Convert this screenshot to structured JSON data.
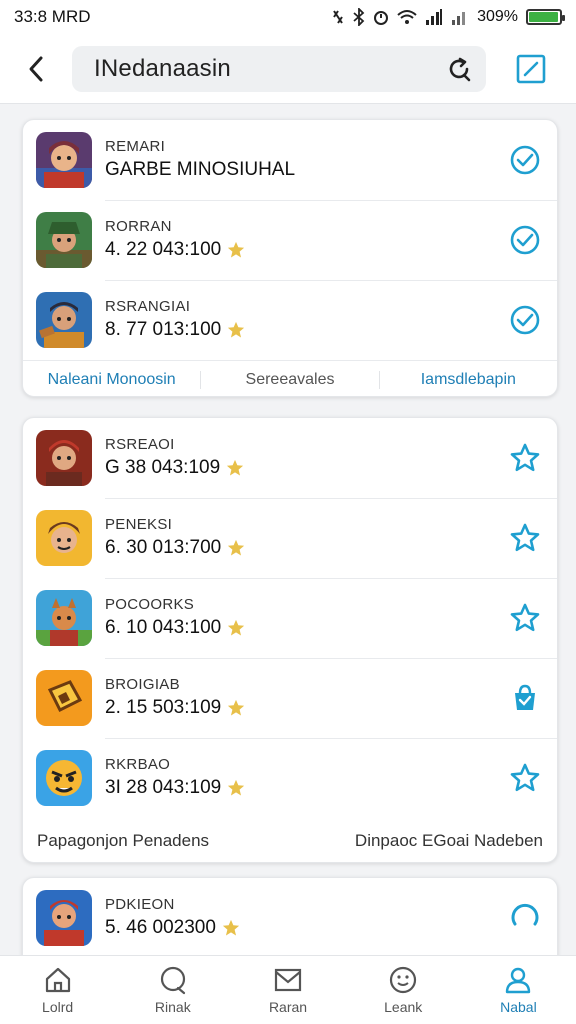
{
  "status_bar": {
    "time": "33:8 MRD",
    "battery_text": "309%",
    "battery_level": 0.95,
    "icons": [
      "nfc-icon",
      "bluetooth-icon",
      "alarm-icon",
      "wifi-icon",
      "signal-icon",
      "signal-icon-2",
      "battery-icon"
    ]
  },
  "header": {
    "search_value": "INedanaasin",
    "back_icon": "chevron-left-icon",
    "refresh_icon": "refresh-icon",
    "edit_icon": "edit-icon"
  },
  "colors": {
    "accent": "#1f9fd0",
    "star": "#e8c04a",
    "active_text": "#1f7fb5"
  },
  "card1": {
    "rows": [
      {
        "title": "REMARI",
        "sub": "GARBE MINOSIUHAL",
        "has_star": false,
        "action": "check-circle-icon"
      },
      {
        "title": "RORRAN",
        "sub": "4. 22 043:100",
        "has_star": true,
        "action": "check-circle-icon"
      },
      {
        "title": "RSRANGIAI",
        "sub": "8. 77 013:100",
        "has_star": true,
        "action": "check-circle-icon"
      }
    ],
    "footer_tabs": [
      "Naleani Monoosin",
      "Sereeavales",
      "Iamsdlebapin"
    ]
  },
  "card2": {
    "rows": [
      {
        "title": "RSREAOI",
        "sub": "G 38 043:109",
        "has_star": true,
        "action": "star-outline-icon"
      },
      {
        "title": "PENEKSI",
        "sub": "6. 30 013:700",
        "has_star": true,
        "action": "star-outline-icon"
      },
      {
        "title": "POCOORKS",
        "sub": "6. 10 043:100",
        "has_star": true,
        "action": "star-outline-icon"
      },
      {
        "title": "BROIGIAB",
        "sub": "2. 15 503:109",
        "has_star": true,
        "action": "shopping-bag-icon"
      },
      {
        "title": "RKRBAO",
        "sub": "3I 28 043:109",
        "has_star": true,
        "action": "star-outline-icon"
      }
    ],
    "footer_left": "Papagonjon Penadens",
    "footer_right": "Dinpaoc  EGoai Nadeben"
  },
  "card3": {
    "rows": [
      {
        "title": "PDKIEON",
        "sub": "5. 46 002300",
        "has_star": true,
        "action": "loading-spinner-icon"
      }
    ]
  },
  "tab_bar": {
    "tabs": [
      {
        "label": "Lolrd",
        "icon": "home-icon",
        "active": false
      },
      {
        "label": "Rinak",
        "icon": "chat-icon",
        "active": false
      },
      {
        "label": "Raran",
        "icon": "mail-icon",
        "active": false
      },
      {
        "label": "Leank",
        "icon": "emoji-icon",
        "active": false
      },
      {
        "label": "Nabal",
        "icon": "profile-icon",
        "active": true
      }
    ]
  }
}
